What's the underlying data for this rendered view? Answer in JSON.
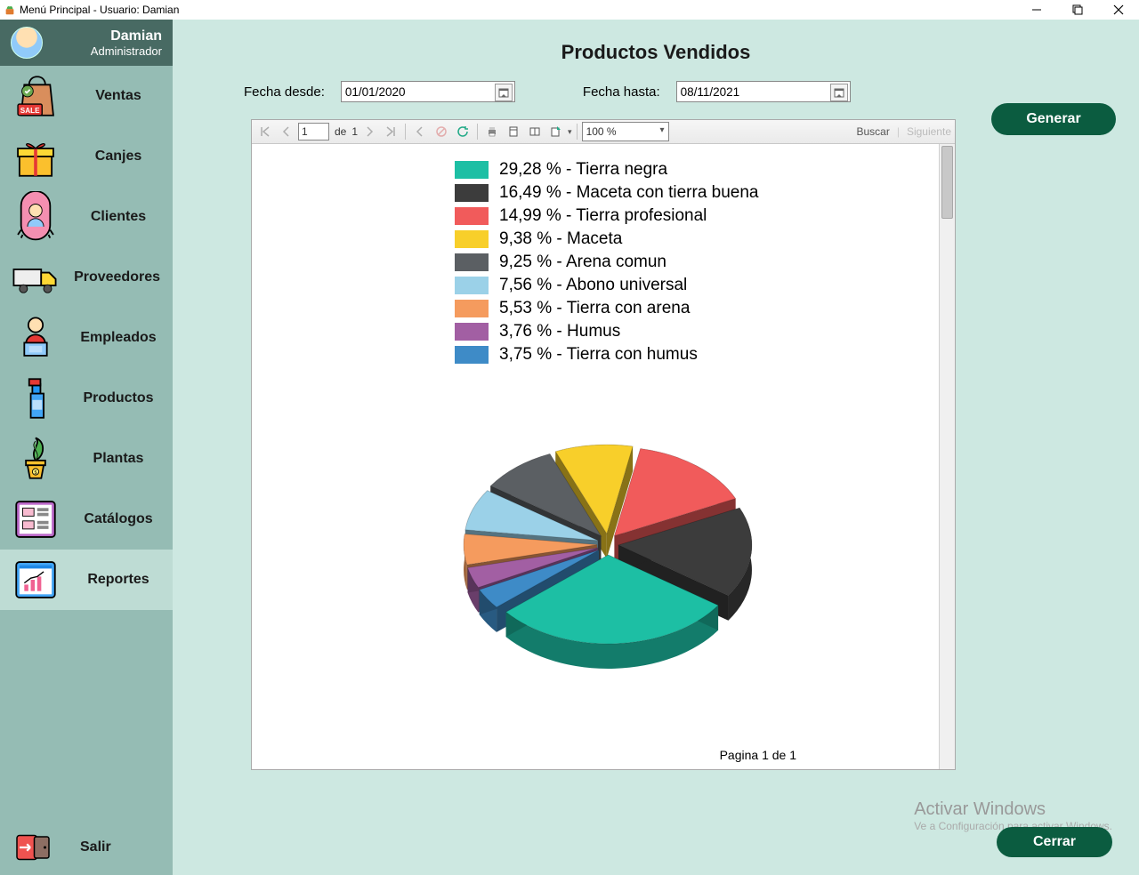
{
  "window": {
    "title": "Menú Principal - Usuario: Damian"
  },
  "user": {
    "name": "Damian",
    "role": "Administrador"
  },
  "sidebar": {
    "items": [
      {
        "id": "ventas",
        "label": "Ventas"
      },
      {
        "id": "canjes",
        "label": "Canjes"
      },
      {
        "id": "clientes",
        "label": "Clientes"
      },
      {
        "id": "proveedores",
        "label": "Proveedores"
      },
      {
        "id": "empleados",
        "label": "Empleados"
      },
      {
        "id": "productos",
        "label": "Productos"
      },
      {
        "id": "plantas",
        "label": "Plantas"
      },
      {
        "id": "catalogos",
        "label": "Catálogos"
      },
      {
        "id": "reportes",
        "label": "Reportes"
      }
    ],
    "exit_label": "Salir"
  },
  "report": {
    "title": "Productos Vendidos",
    "from_label": "Fecha desde:",
    "to_label": "Fecha hasta:",
    "from_value": "01/01/2020",
    "to_value": "08/11/2021",
    "generate_btn": "Generar",
    "close_btn": "Cerrar",
    "toolbar": {
      "page_current": "1",
      "page_of": "de",
      "page_total": "1",
      "zoom": "100 %",
      "find": "Buscar",
      "next": "Siguiente"
    },
    "page_footer": "Pagina 1 de 1"
  },
  "watermark": {
    "line1": "Activar Windows",
    "line2": "Ve a Configuración para activar Windows."
  },
  "chart_data": {
    "type": "pie",
    "title": "Productos Vendidos",
    "series": [
      {
        "name": "Tierra negra",
        "value": 29.28,
        "label": "29,28 % - Tierra negra",
        "color": "#1dbfa4"
      },
      {
        "name": "Maceta con tierra buena",
        "value": 16.49,
        "label": "16,49 % - Maceta con tierra buena",
        "color": "#3c3c3c"
      },
      {
        "name": "Tierra profesional",
        "value": 14.99,
        "label": "14,99 % - Tierra profesional",
        "color": "#f15b5b"
      },
      {
        "name": "Maceta",
        "value": 9.38,
        "label": "9,38 % - Maceta",
        "color": "#f8cf2a"
      },
      {
        "name": "Arena comun",
        "value": 9.25,
        "label": "9,25 % - Arena comun",
        "color": "#5b5f63"
      },
      {
        "name": "Abono universal",
        "value": 7.56,
        "label": "7,56 % - Abono universal",
        "color": "#9bd1e8"
      },
      {
        "name": "Tierra con arena",
        "value": 5.53,
        "label": "5,53 % - Tierra con arena",
        "color": "#f59b5e"
      },
      {
        "name": "Humus",
        "value": 3.76,
        "label": "3,76 % - Humus",
        "color": "#a25fa3"
      },
      {
        "name": "Tierra con humus",
        "value": 3.75,
        "label": "3,75 % - Tierra con humus",
        "color": "#3e8bc7"
      }
    ]
  }
}
